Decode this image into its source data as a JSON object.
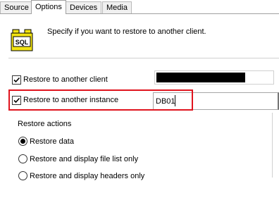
{
  "tabs": [
    {
      "label": "Source",
      "active": false
    },
    {
      "label": "Options",
      "active": true
    },
    {
      "label": "Devices",
      "active": false
    },
    {
      "label": "Media",
      "active": false
    }
  ],
  "header": {
    "description": "Specify if you want to restore to another client.",
    "icon": "sql-database-icon"
  },
  "options": {
    "restore_client": {
      "label": "Restore to another client",
      "checked": true,
      "value_redacted": true
    },
    "restore_instance": {
      "label": "Restore to another instance",
      "checked": true,
      "value": "DB01"
    }
  },
  "restore_actions": {
    "title": "Restore actions",
    "items": [
      {
        "label": "Restore data",
        "selected": true
      },
      {
        "label": "Restore and display file list only",
        "selected": false
      },
      {
        "label": "Restore and display headers only",
        "selected": false
      }
    ]
  },
  "colors": {
    "highlight": "#e0141e",
    "icon_yellow": "#f2e313"
  }
}
